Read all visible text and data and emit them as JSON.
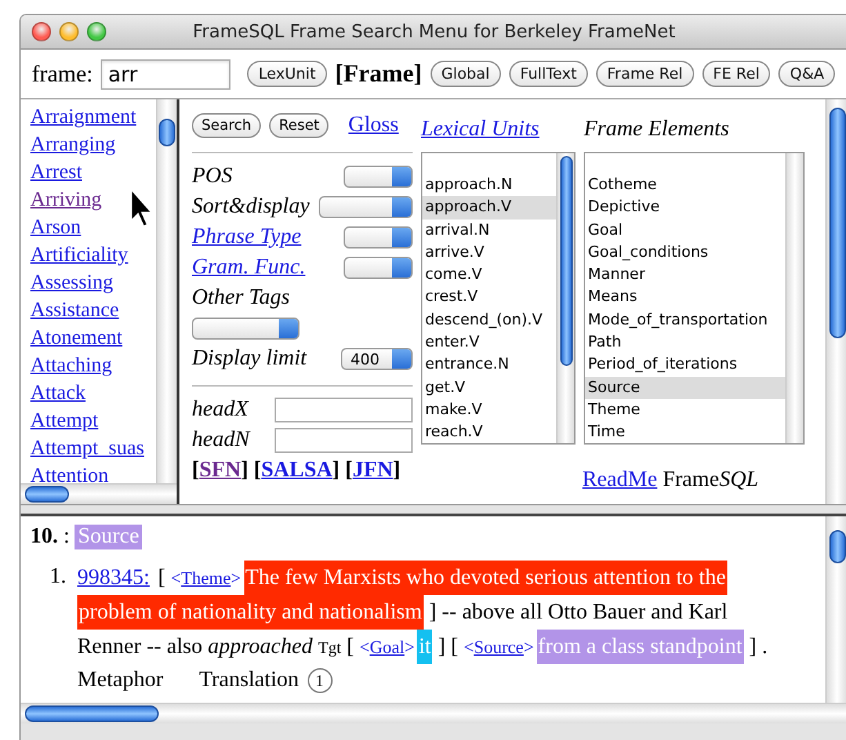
{
  "window": {
    "title": "FrameSQL Frame Search Menu for Berkeley FrameNet"
  },
  "toolbar": {
    "label": "frame:",
    "input": {
      "value": "arr"
    },
    "items": [
      {
        "kind": "button",
        "label": "LexUnit"
      },
      {
        "kind": "current",
        "label": "[Frame]"
      },
      {
        "kind": "button",
        "label": "Global"
      },
      {
        "kind": "button",
        "label": "FullText"
      },
      {
        "kind": "button",
        "label": "Frame Rel"
      },
      {
        "kind": "button",
        "label": "FE Rel"
      },
      {
        "kind": "button",
        "label": "Q&A"
      }
    ]
  },
  "frame_list": [
    {
      "label": "Arraignment",
      "visited": false
    },
    {
      "label": "Arranging",
      "visited": false
    },
    {
      "label": "Arrest",
      "visited": false
    },
    {
      "label": "Arriving",
      "visited": true
    },
    {
      "label": "Arson",
      "visited": false
    },
    {
      "label": "Artificiality",
      "visited": false
    },
    {
      "label": "Assessing",
      "visited": false
    },
    {
      "label": "Assistance",
      "visited": false
    },
    {
      "label": "Atonement",
      "visited": false
    },
    {
      "label": "Attaching",
      "visited": false
    },
    {
      "label": "Attack",
      "visited": false
    },
    {
      "label": "Attempt",
      "visited": false
    },
    {
      "label": "Attempt_suas",
      "visited": false
    },
    {
      "label": "Attention",
      "visited": false
    }
  ],
  "form": {
    "buttons": [
      "Search",
      "Reset"
    ],
    "gloss": "Gloss",
    "fields": [
      {
        "label": "POS",
        "kind": "plain"
      },
      {
        "label": "Sort&display",
        "kind": "plain"
      },
      {
        "label": "Phrase Type",
        "kind": "link"
      },
      {
        "label": "Gram. Func.",
        "kind": "link"
      },
      {
        "label": "Other Tags",
        "kind": "below"
      },
      {
        "label": "Display limit",
        "kind": "plain",
        "value": "400"
      }
    ],
    "heads": [
      {
        "label": "headX"
      },
      {
        "label": "headN"
      }
    ],
    "links": [
      {
        "open": "[",
        "label": "SFN",
        "close": "]",
        "visited": true
      },
      {
        "open": "[",
        "label": "SALSA",
        "close": "]",
        "visited": false
      },
      {
        "open": "[",
        "label": "JFN",
        "close": "]",
        "visited": false
      }
    ]
  },
  "lexical_units": {
    "title": "Lexical Units",
    "items": [
      {
        "label": "approach.N",
        "selected": false
      },
      {
        "label": "approach.V",
        "selected": true
      },
      {
        "label": "arrival.N",
        "selected": false
      },
      {
        "label": "arrive.V",
        "selected": false
      },
      {
        "label": "come.V",
        "selected": false
      },
      {
        "label": "crest.V",
        "selected": false
      },
      {
        "label": "descend_(on).V",
        "selected": false
      },
      {
        "label": "enter.V",
        "selected": false
      },
      {
        "label": "entrance.N",
        "selected": false
      },
      {
        "label": "get.V",
        "selected": false
      },
      {
        "label": "make.V",
        "selected": false
      },
      {
        "label": "reach.V",
        "selected": false
      }
    ]
  },
  "frame_elements": {
    "title": "Frame Elements",
    "items": [
      {
        "label": "Cotheme",
        "selected": false
      },
      {
        "label": "Depictive",
        "selected": false
      },
      {
        "label": "Goal",
        "selected": false
      },
      {
        "label": "Goal_conditions",
        "selected": false
      },
      {
        "label": "Manner",
        "selected": false
      },
      {
        "label": "Means",
        "selected": false
      },
      {
        "label": "Mode_of_transportation",
        "selected": false
      },
      {
        "label": "Path",
        "selected": false
      },
      {
        "label": "Period_of_iterations",
        "selected": false
      },
      {
        "label": "Source",
        "selected": true
      },
      {
        "label": "Theme",
        "selected": false
      },
      {
        "label": "Time",
        "selected": false
      }
    ]
  },
  "footer": {
    "link": "ReadMe",
    "brand": [
      "Frame",
      "SQL"
    ]
  },
  "result": {
    "number": "10.",
    "separator": ":",
    "tag": {
      "label": "Source",
      "color": "#b294e8"
    },
    "examples": [
      {
        "marker": "1.",
        "lines": [
          [
            {
              "kind": "link",
              "text": "998345:"
            },
            {
              "kind": "text",
              "text": "["
            },
            {
              "kind": "fe",
              "open": "<",
              "text": "Theme",
              "close": ">"
            },
            {
              "kind": "highlight",
              "text": "The few Marxists who devoted serious attention to the",
              "color": "#ff2a00"
            }
          ],
          [
            {
              "kind": "highlight",
              "text": "problem of nationality and nationalism",
              "color": "#ff2a00"
            },
            {
              "kind": "text",
              "text": "] -- above all Otto Bauer and Karl"
            }
          ],
          [
            {
              "kind": "text",
              "text": "Renner -- also"
            },
            {
              "kind": "target",
              "text": "approached"
            },
            {
              "kind": "sup",
              "text": "Tgt"
            },
            {
              "kind": "text",
              "text": "["
            },
            {
              "kind": "fe",
              "open": "<",
              "text": "Goal",
              "close": ">"
            },
            {
              "kind": "highlight",
              "text": "it",
              "color": "#14c0f0"
            },
            {
              "kind": "text",
              "text": "] ["
            },
            {
              "kind": "fe",
              "open": "<",
              "text": "Source",
              "close": ">"
            },
            {
              "kind": "highlight",
              "text": "from a class standpoint",
              "color": "#b294e8"
            },
            {
              "kind": "text",
              "text": "] ."
            }
          ]
        ],
        "notes": [
          "Metaphor",
          "Translation"
        ],
        "count": "1"
      }
    ]
  }
}
